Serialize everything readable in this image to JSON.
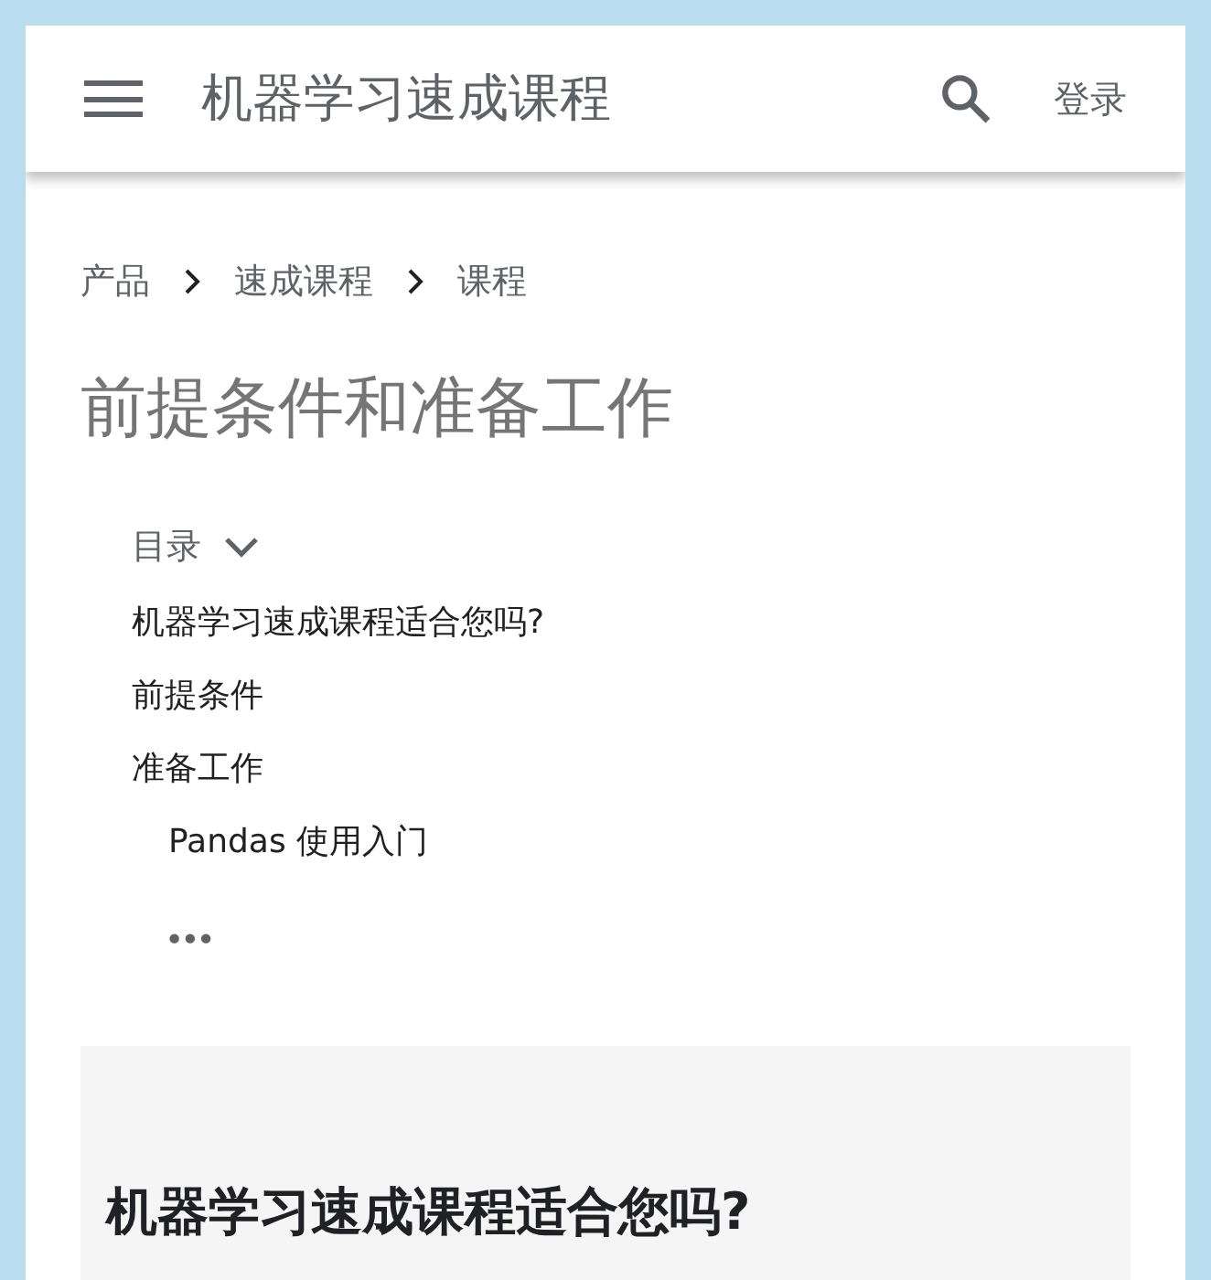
{
  "header": {
    "title": "机器学习速成课程",
    "login": "登录"
  },
  "breadcrumbs": [
    {
      "label": "产品"
    },
    {
      "label": "速成课程"
    },
    {
      "label": "课程"
    }
  ],
  "page_title": "前提条件和准备工作",
  "toc": {
    "label": "目录",
    "items": [
      {
        "label": "机器学习速成课程适合您吗?"
      },
      {
        "label": "前提条件"
      },
      {
        "label": "准备工作",
        "children": [
          {
            "label": "Pandas 使用入门"
          }
        ]
      }
    ],
    "more": "•••"
  },
  "section": {
    "heading": "机器学习速成课程适合您吗?"
  }
}
